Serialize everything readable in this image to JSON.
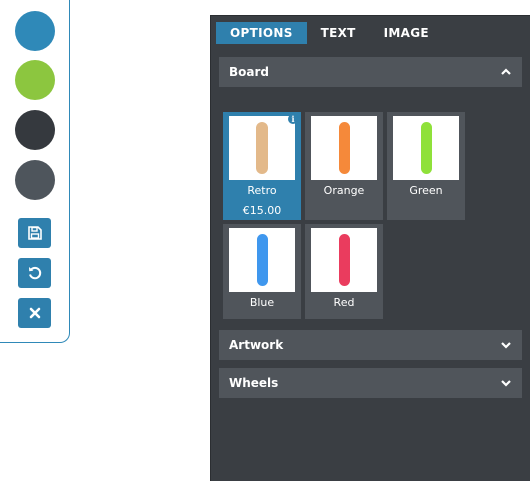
{
  "toolbar": {
    "swatches": [
      {
        "name": "blue",
        "color": "#2f89b8"
      },
      {
        "name": "green",
        "color": "#8cc63f"
      },
      {
        "name": "dark",
        "color": "#35393e"
      },
      {
        "name": "grey",
        "color": "#4e555c"
      }
    ],
    "buttons": [
      "save-icon",
      "undo-icon",
      "close-icon"
    ]
  },
  "panel": {
    "tabs": [
      {
        "label": "OPTIONS",
        "active": true
      },
      {
        "label": "TEXT",
        "active": false
      },
      {
        "label": "IMAGE",
        "active": false
      }
    ],
    "sections": [
      {
        "title": "Board",
        "expanded": true
      },
      {
        "title": "Artwork",
        "expanded": false
      },
      {
        "title": "Wheels",
        "expanded": false
      }
    ],
    "boards": [
      {
        "label": "Retro",
        "price": "€15.00",
        "selected": true,
        "color": "#e3b98a"
      },
      {
        "label": "Orange",
        "price": "",
        "selected": false,
        "color": "#f5893a"
      },
      {
        "label": "Green",
        "price": "",
        "selected": false,
        "color": "#8fe13a"
      },
      {
        "label": "Blue",
        "price": "",
        "selected": false,
        "color": "#3f97ee"
      },
      {
        "label": "Red",
        "price": "",
        "selected": false,
        "color": "#ea3c5e"
      }
    ],
    "info_badge": "i"
  },
  "colors": {
    "accent": "#2f80ad",
    "panel_bg": "#3a3e43",
    "section_bg": "#50555b"
  }
}
